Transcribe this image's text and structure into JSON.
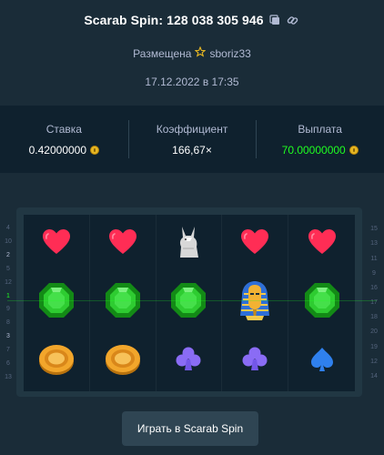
{
  "header": {
    "title": "Scarab Spin: 128 038 305 946",
    "placed_label": "Размещена",
    "username": "sboriz33",
    "date": "17.12.2022 в 17:35"
  },
  "stats": {
    "bet_label": "Ставка",
    "bet_value": "0.42000000",
    "multiplier_label": "Коэффициент",
    "multiplier_value": "166,67×",
    "payout_label": "Выплата",
    "payout_value": "70.00000000"
  },
  "reels": [
    [
      "heart",
      "heart",
      "anubis",
      "heart",
      "heart"
    ],
    [
      "emerald",
      "emerald",
      "emerald",
      "pharaoh",
      "emerald"
    ],
    [
      "coin",
      "coin",
      "club",
      "club",
      "spade"
    ]
  ],
  "side_left": [
    "4",
    "10",
    "2",
    "5",
    "12",
    "1",
    "9",
    "8",
    "3",
    "7",
    "6",
    "13"
  ],
  "side_right": [
    "15",
    "13",
    "11",
    "9",
    "16",
    "17",
    "18",
    "20",
    "19",
    "12",
    "14"
  ],
  "play_button": "Играть в Scarab Spin",
  "colors": {
    "background": "#1a2c38",
    "panel": "#0f212e",
    "payout": "#1fff20",
    "button": "#2f4553"
  }
}
